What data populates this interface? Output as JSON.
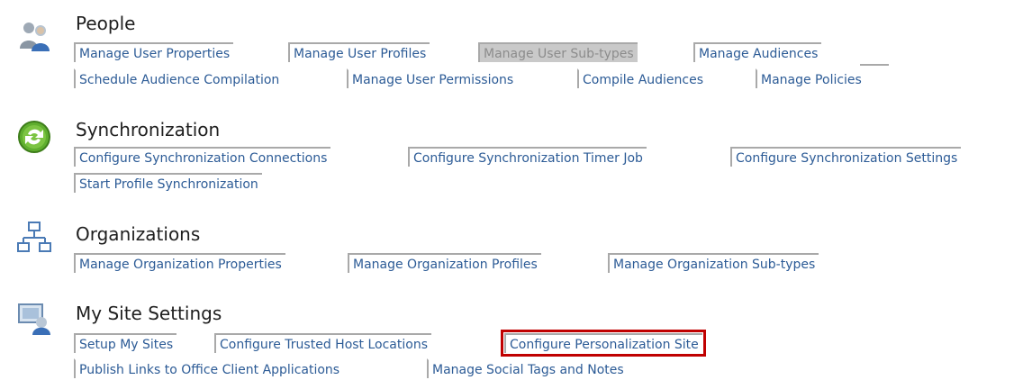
{
  "sections": [
    {
      "title": "People",
      "icon": "people-icon",
      "links": [
        "Manage User Properties",
        "Manage User Profiles",
        "Manage User Sub-types",
        "Manage Audiences",
        "Schedule Audience Compilation",
        "Manage User Permissions",
        "Compile Audiences",
        "Manage Policies"
      ]
    },
    {
      "title": "Synchronization",
      "icon": "sync-icon",
      "links": [
        "Configure Synchronization Connections",
        "Configure Synchronization Timer Job",
        "Configure Synchronization Settings",
        "Start Profile Synchronization"
      ]
    },
    {
      "title": "Organizations",
      "icon": "org-chart-icon",
      "links": [
        "Manage Organization Properties",
        "Manage Organization Profiles",
        "Manage Organization Sub-types"
      ]
    },
    {
      "title": "My Site Settings",
      "icon": "my-site-icon",
      "links": [
        "Setup My Sites",
        "Configure Trusted Host Locations",
        "Configure Personalization Site",
        "Publish Links to Office Client Applications",
        "Manage Social Tags and Notes"
      ]
    }
  ],
  "states": {
    "disabled_link": "Manage User Sub-types",
    "highlighted_link": "Configure Personalization Site"
  },
  "colors": {
    "link": "#2c5b96",
    "highlight_border": "#c00000",
    "disabled_bg": "#c9c9c9"
  }
}
